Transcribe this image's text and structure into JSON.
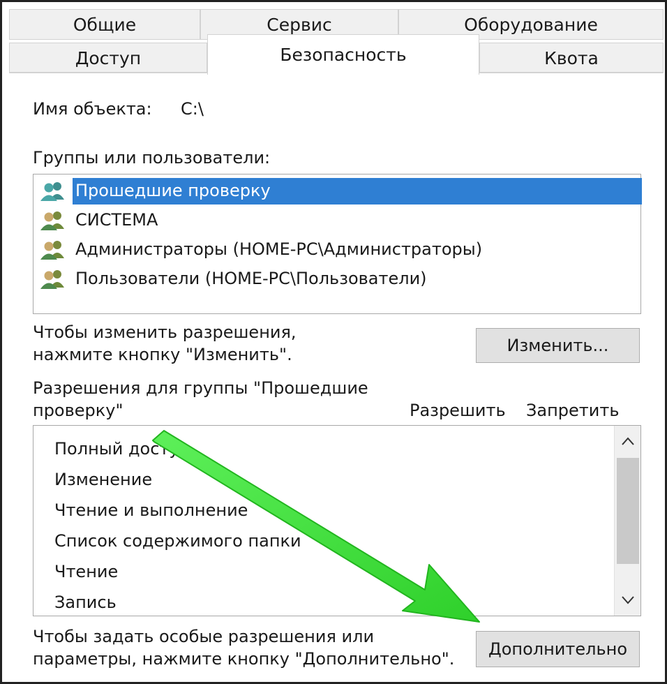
{
  "tabs": {
    "row_top": [
      "Общие",
      "Сервис",
      "Оборудование"
    ],
    "row_bottom": [
      "Доступ",
      "Безопасность",
      "Квота"
    ],
    "active": "Безопасность"
  },
  "object": {
    "label": "Имя объекта:",
    "value": "C:\\"
  },
  "groups": {
    "label": "Группы или пользователи:",
    "items": [
      {
        "name": "Прошедшие проверку",
        "icon": "users-group-icon",
        "selected": true
      },
      {
        "name": "СИСТЕМА",
        "icon": "users-group-icon",
        "selected": false
      },
      {
        "name": "Администраторы (HOME-PC\\Администраторы)",
        "icon": "users-group-icon",
        "selected": false
      },
      {
        "name": "Пользователи (HOME-PC\\Пользователи)",
        "icon": "users-group-icon",
        "selected": false
      }
    ]
  },
  "change_hint": {
    "line1": "Чтобы изменить разрешения,",
    "line2": "нажмите кнопку \"Изменить\"."
  },
  "change_button": "Изменить...",
  "permissions": {
    "title_line1": "Разрешения для группы \"Прошедшие",
    "title_line2": "проверку\"",
    "col_allow": "Разрешить",
    "col_deny": "Запретить",
    "items": [
      "Полный доступ",
      "Изменение",
      "Чтение и выполнение",
      "Список содержимого папки",
      "Чтение",
      "Запись"
    ]
  },
  "advanced_hint": {
    "line1": "Чтобы задать особые разрешения или",
    "line2": "параметры, нажмите кнопку \"Дополнительно\"."
  },
  "advanced_button": "Дополнительно",
  "colors": {
    "selection": "#2f7fd3",
    "annotation_arrow": "#3de33a"
  }
}
